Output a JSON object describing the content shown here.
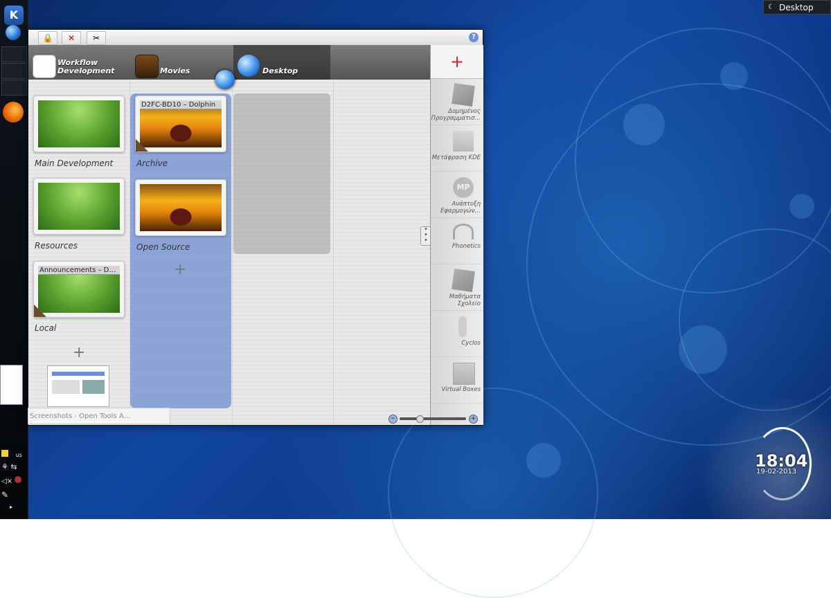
{
  "desktop": {
    "label": "Desktop"
  },
  "window": {
    "tabs": [
      {
        "label_line1": "Workflow",
        "label_line2": "Development"
      },
      {
        "label": "Movies"
      },
      {
        "label": "Desktop"
      }
    ],
    "column1": {
      "items": [
        {
          "caption": "Main Development"
        },
        {
          "caption": "Resources"
        },
        {
          "caption": "Local",
          "window_title": "Announcements – D…"
        }
      ]
    },
    "column2": {
      "items": [
        {
          "caption": "Archive",
          "window_title": "D2FC-BD10 – Dolphin"
        },
        {
          "caption": "Open Source"
        }
      ]
    },
    "add_symbol": "+",
    "taskbar_tip": "Screenshots - Open Tools A…"
  },
  "activities": {
    "add_symbol": "+",
    "items": [
      {
        "label": "Δομημένος Προγραμματισ…",
        "icon": "book-icon"
      },
      {
        "label": "Μετάφραση KDE",
        "icon": "flag-icon"
      },
      {
        "label": "Ανάπτυξη Εφαρμογών…",
        "icon": "mp-icon"
      },
      {
        "label": "Phonetics",
        "icon": "headphones-icon"
      },
      {
        "label": "Μαθήματα Σχολείο",
        "icon": "book-icon"
      },
      {
        "label": "Cyclos",
        "icon": "figure-icon"
      },
      {
        "label": "Virtual Boxes",
        "icon": "box-icon"
      }
    ]
  },
  "tray": {
    "keyboard_layout": "us"
  },
  "clock": {
    "time": "18:04",
    "date": "19-02-2013"
  }
}
